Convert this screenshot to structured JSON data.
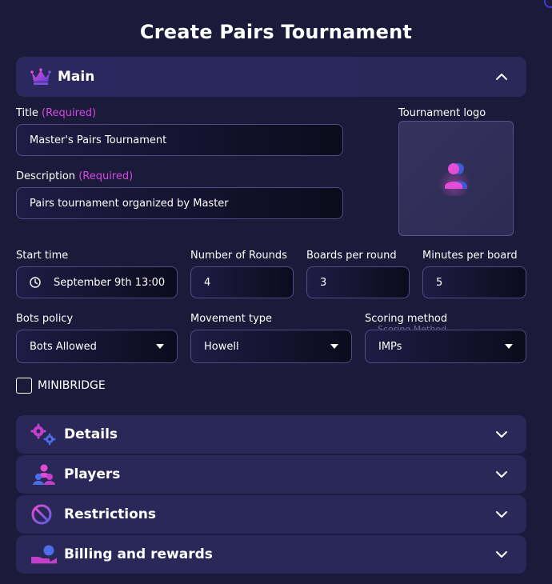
{
  "page_title": "Create Pairs Tournament",
  "main_section": {
    "title": "Main",
    "expanded": true,
    "title_label": "Title",
    "title_required": "(Required)",
    "title_value": "Master's Pairs Tournament",
    "description_label": "Description",
    "description_required": "(Required)",
    "description_value": "Pairs tournament organized by Master",
    "logo_label": "Tournament logo",
    "start_time_label": "Start time",
    "start_time_value": "September 9th 13:00",
    "rounds_label": "Number of Rounds",
    "rounds_value": "4",
    "boards_label": "Boards per round",
    "boards_value": "3",
    "minutes_label": "Minutes per board",
    "minutes_value": "5",
    "bots_label": "Bots policy",
    "bots_value": "Bots Allowed",
    "movement_label": "Movement type",
    "movement_value": "Howell",
    "scoring_label": "Scoring method",
    "scoring_ghost": "Scoring Method",
    "scoring_value": "IMPs",
    "minibridge_label": "MINIBRIDGE",
    "minibridge_checked": false
  },
  "sections": [
    {
      "title": "Details",
      "icon": "gears-icon"
    },
    {
      "title": "Players",
      "icon": "players-icon"
    },
    {
      "title": "Restrictions",
      "icon": "prohibited-icon"
    },
    {
      "title": "Billing and rewards",
      "icon": "billing-icon"
    }
  ],
  "colors": {
    "background": "#1b1a3a",
    "panel": "#2a2759",
    "required": "#d44ae0",
    "accent_pink": "#e44dd6",
    "accent_blue": "#3d5bd9"
  }
}
